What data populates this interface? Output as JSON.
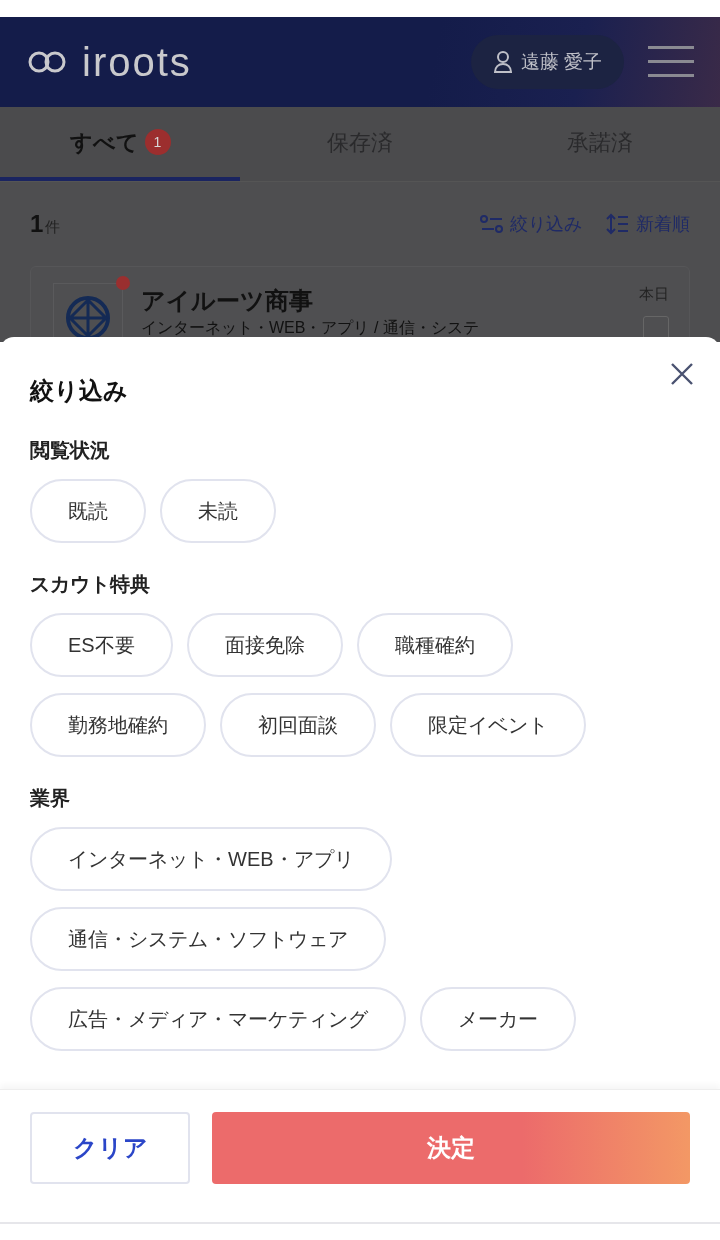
{
  "header": {
    "logo": "iroots",
    "user": "遠藤 愛子"
  },
  "tabs": [
    {
      "label": "すべて",
      "badge": "1",
      "selected": true
    },
    {
      "label": "保存済",
      "selected": false
    },
    {
      "label": "承諾済",
      "selected": false
    }
  ],
  "list": {
    "count": "1",
    "count_unit": "件",
    "filter_link": "絞り込み",
    "sort_link": "新着順"
  },
  "scouts": [
    {
      "company": "アイルーツ商事",
      "industry": "インターネット・WEB・アプリ / 通信・システ",
      "date": "本日",
      "unread": true,
      "checked": false
    }
  ],
  "filter_sheet": {
    "title": "絞り込み",
    "sections": [
      {
        "heading": "閲覧状況",
        "options": [
          {
            "label": "既読",
            "selected": false
          },
          {
            "label": "未読",
            "selected": false
          }
        ]
      },
      {
        "heading": "スカウト特典",
        "options": [
          {
            "label": "ES不要",
            "selected": false
          },
          {
            "label": "面接免除",
            "selected": false
          },
          {
            "label": "職種確約",
            "selected": false
          },
          {
            "label": "勤務地確約",
            "selected": false
          },
          {
            "label": "初回面談",
            "selected": false
          },
          {
            "label": "限定イベント",
            "selected": false
          }
        ]
      },
      {
        "heading": "業界",
        "options": [
          {
            "label": "インターネット・WEB・アプリ",
            "selected": false
          },
          {
            "label": "通信・システム・ソフトウェア",
            "selected": false
          },
          {
            "label": "広告・メディア・マーケティング",
            "selected": false
          },
          {
            "label": "メーカー",
            "selected": false
          }
        ]
      }
    ],
    "clear_button": "クリア",
    "apply_button": "決定"
  }
}
